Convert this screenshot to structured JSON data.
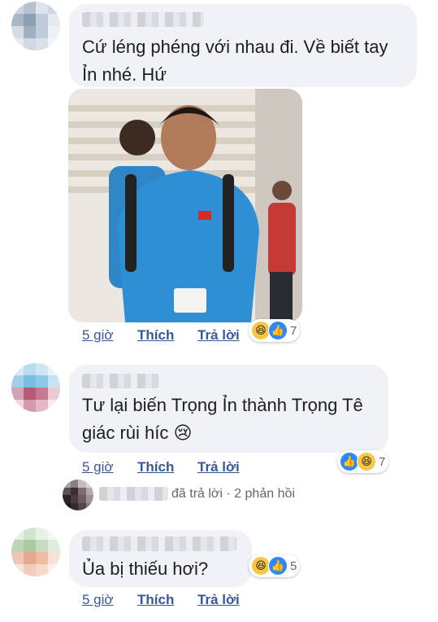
{
  "comments": [
    {
      "text": "Cứ léng phéng với nhau đi. Về biết tay Ỉn nhé. Hứ",
      "time": "5 giờ",
      "like": "Thích",
      "reply": "Trả lời",
      "reactions": {
        "icons": [
          "haha-icon",
          "like-icon"
        ],
        "count": "7"
      }
    },
    {
      "text": "Tư lại biến Trọng Ỉn thành Trọng Tê giác rùi híc 😢",
      "time": "5 giờ",
      "like": "Thích",
      "reply": "Trả lời",
      "reactions": {
        "icons": [
          "like-icon",
          "haha-icon"
        ],
        "count": "7"
      },
      "replies_summary": "đã trả lời · 2 phản hồi"
    },
    {
      "text": "Ủa bị thiếu hơi?",
      "time": "5 giờ",
      "like": "Thích",
      "reply": "Trả lời",
      "reactions": {
        "icons": [
          "haha-icon",
          "like-icon"
        ],
        "count": "5"
      }
    }
  ],
  "colors": {
    "link": "#385898",
    "bubble": "#f1f2f6",
    "like": "#2d88ff",
    "haha": "#f7c844"
  }
}
